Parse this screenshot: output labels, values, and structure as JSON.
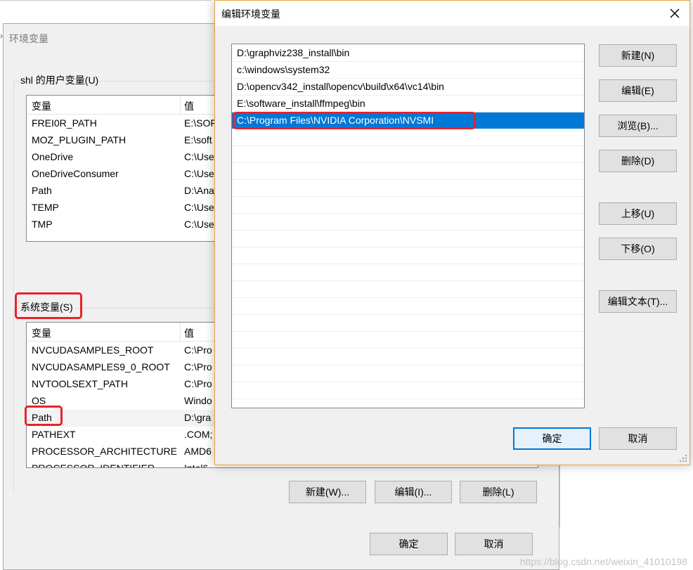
{
  "env_dialog": {
    "title": "环境变量",
    "user_vars": {
      "label": "shl 的用户变量(U)",
      "columns": [
        "变量",
        "值"
      ],
      "rows": [
        {
          "name": "FREI0R_PATH",
          "value": "E:\\SOF"
        },
        {
          "name": "MOZ_PLUGIN_PATH",
          "value": "E:\\soft"
        },
        {
          "name": "OneDrive",
          "value": "C:\\Use"
        },
        {
          "name": "OneDriveConsumer",
          "value": "C:\\Use"
        },
        {
          "name": "Path",
          "value": "D:\\Ana"
        },
        {
          "name": "TEMP",
          "value": "C:\\Use"
        },
        {
          "name": "TMP",
          "value": "C:\\Use"
        }
      ]
    },
    "system_vars": {
      "label": "系统变量(S)",
      "columns": [
        "变量",
        "值"
      ],
      "rows": [
        {
          "name": "NVCUDASAMPLES_ROOT",
          "value": "C:\\Pro"
        },
        {
          "name": "NVCUDASAMPLES9_0_ROOT",
          "value": "C:\\Pro"
        },
        {
          "name": "NVTOOLSEXT_PATH",
          "value": "C:\\Pro"
        },
        {
          "name": "OS",
          "value": "Windo"
        },
        {
          "name": "Path",
          "value": "D:\\gra"
        },
        {
          "name": "PATHEXT",
          "value": ".COM;"
        },
        {
          "name": "PROCESSOR_ARCHITECTURE",
          "value": "AMD6"
        },
        {
          "name": "PROCESSOR_IDENTIFIER",
          "value": "Intel6"
        }
      ],
      "buttons": {
        "new": "新建(W)...",
        "edit": "编辑(I)...",
        "delete": "删除(L)"
      }
    },
    "ok": "确定",
    "cancel": "取消"
  },
  "edit_dialog": {
    "title": "编辑环境变量",
    "entries": [
      "D:\\graphviz238_install\\bin",
      "c:\\windows\\system32",
      "D:\\opencv342_install\\opencv\\build\\x64\\vc14\\bin",
      "E:\\software_install\\ffmpeg\\bin",
      "C:\\Program Files\\NVIDIA Corporation\\NVSMI"
    ],
    "selected_index": 4,
    "buttons": {
      "new": "新建(N)",
      "edit": "编辑(E)",
      "browse": "浏览(B)...",
      "delete": "删除(D)",
      "up": "上移(U)",
      "down": "下移(O)",
      "edit_text": "编辑文本(T)...",
      "ok": "确定",
      "cancel": "取消"
    }
  },
  "watermark": "https://blog.csdn.net/weixin_41010198",
  "background": {
    "edge_glyph": "›"
  },
  "colors": {
    "accent": "#0078d7",
    "highlight_box": "#e8222b",
    "dialog_bg": "#f0f0f0"
  }
}
